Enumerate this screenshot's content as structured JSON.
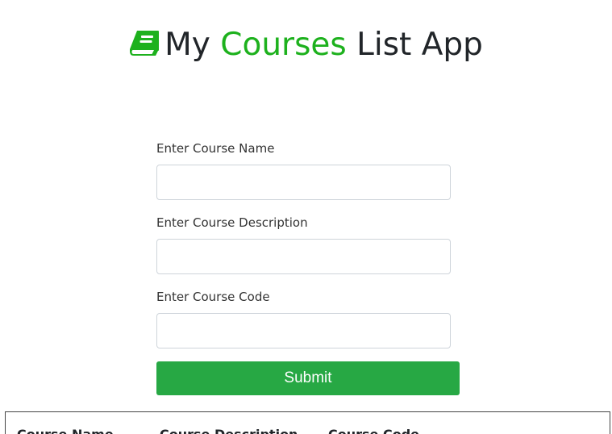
{
  "header": {
    "icon": "book-icon",
    "title_prefix": "My",
    "title_accent": "Courses",
    "title_suffix": "List App",
    "accent_color": "#1db11d"
  },
  "form": {
    "course_name": {
      "label": "Enter Course Name",
      "value": "",
      "placeholder": ""
    },
    "course_description": {
      "label": "Enter Course Description",
      "value": "",
      "placeholder": ""
    },
    "course_code": {
      "label": "Enter Course Code",
      "value": "",
      "placeholder": ""
    },
    "submit_label": "Submit",
    "submit_color": "#27a844"
  },
  "table": {
    "columns": [
      "Course Name",
      "Course Description",
      "Course Code"
    ]
  }
}
